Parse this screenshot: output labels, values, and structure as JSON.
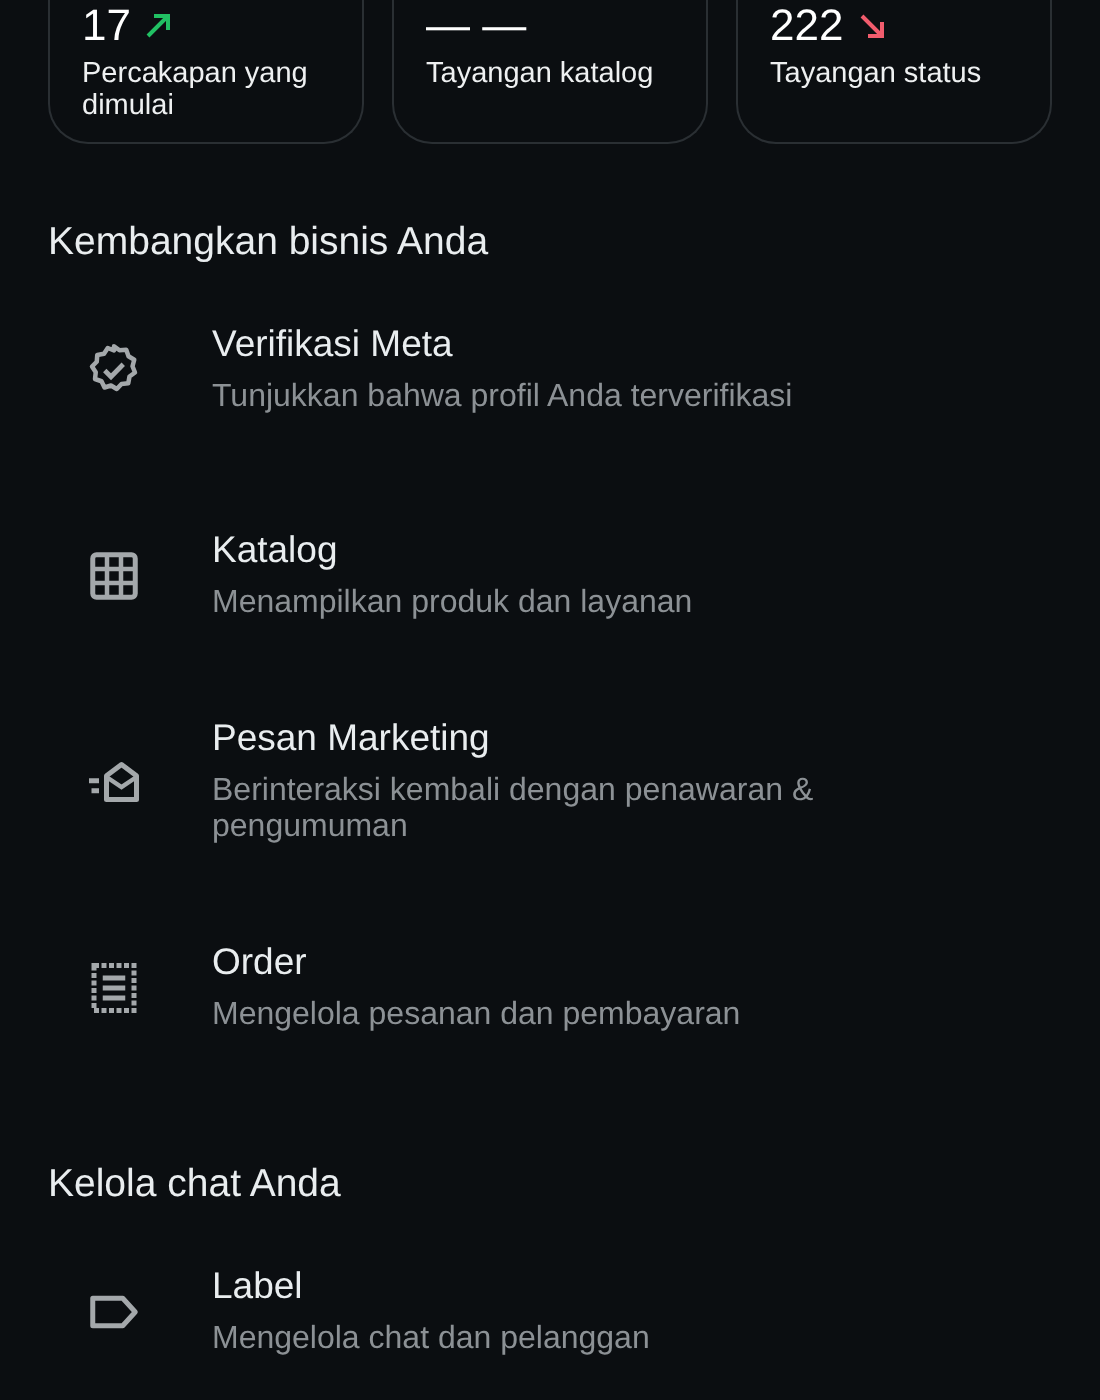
{
  "stats": [
    {
      "value": "17",
      "kind": "up",
      "color": "#21c063",
      "label": "Percakapan yang dimulai"
    },
    {
      "value": "— —",
      "kind": "plain",
      "label": "Tayangan katalog"
    },
    {
      "value": "222",
      "kind": "down",
      "color": "#f15c6d",
      "label": "Tayangan status"
    }
  ],
  "sections": [
    {
      "title": "Kembangkan bisnis Anda",
      "items": [
        {
          "kind": "verified",
          "title": "Verifikasi Meta",
          "subtitle": "Tunjukkan bahwa profil Anda terverifikasi"
        },
        {
          "kind": "grid",
          "title": "Katalog",
          "subtitle": "Menampilkan produk dan layanan"
        },
        {
          "kind": "marketing",
          "title": "Pesan Marketing",
          "subtitle": "Berinteraksi kembali dengan penawaran & pengumuman"
        },
        {
          "kind": "order",
          "title": "Order",
          "subtitle": "Mengelola pesanan dan pembayaran"
        }
      ]
    },
    {
      "title": "Kelola chat Anda",
      "items": [
        {
          "kind": "label",
          "title": "Label",
          "subtitle": "Mengelola chat dan pelanggan"
        }
      ]
    }
  ]
}
